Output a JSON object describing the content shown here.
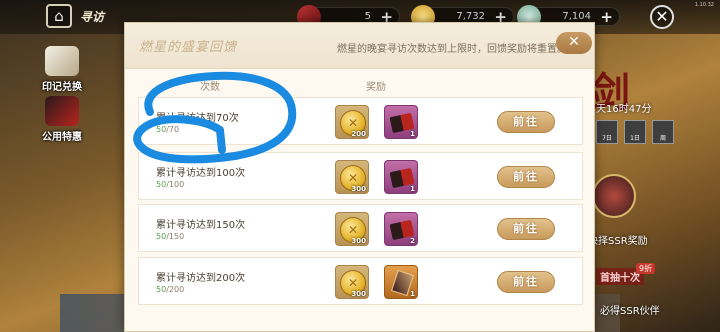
{
  "topbar": {
    "title": "寻访",
    "resources": [
      {
        "name": "ticket",
        "value": "5",
        "plus": "+"
      },
      {
        "name": "gold",
        "value": "7,732",
        "plus": "+"
      },
      {
        "name": "jade",
        "value": "7,104",
        "plus": "+"
      }
    ],
    "version": "1.10.32"
  },
  "sidebar": [
    {
      "label": "印记兑换"
    },
    {
      "label": "公用特惠"
    }
  ],
  "background": {
    "big_char": "剑",
    "timer": "天16时47分",
    "tiles": [
      "7日",
      "1日",
      "周"
    ],
    "ssr_pack_label": "抉择SSR奖励",
    "promo_tag": "首抽十次",
    "promo_badge": "9折",
    "promo_label": "必得SSR伙伴"
  },
  "modal": {
    "title": "燃星的盛宴回馈",
    "description": "燃星的晚宴寻访次数达到上限时，回馈奖励将重置。",
    "close_label": "✕",
    "col_condition": "次数",
    "col_reward": "奖励",
    "rows": [
      {
        "title": "累计寻访达到70次",
        "current": "50",
        "target": "/70",
        "gold_count": "200",
        "item_count": "1",
        "item_type": "book",
        "button": "前往"
      },
      {
        "title": "累计寻访达到100次",
        "current": "50",
        "target": "/100",
        "gold_count": "300",
        "item_count": "1",
        "item_type": "book",
        "button": "前往"
      },
      {
        "title": "累计寻访达到150次",
        "current": "50",
        "target": "/150",
        "gold_count": "300",
        "item_count": "2",
        "item_type": "book",
        "button": "前往"
      },
      {
        "title": "累计寻访达到200次",
        "current": "50",
        "target": "/200",
        "gold_count": "300",
        "item_count": "1",
        "item_type": "fragment",
        "button": "前往"
      }
    ]
  },
  "colors": {
    "annotation_stroke": "#1a8be0",
    "button_gold": "#c89a5c",
    "progress_green": "#5aa050"
  }
}
